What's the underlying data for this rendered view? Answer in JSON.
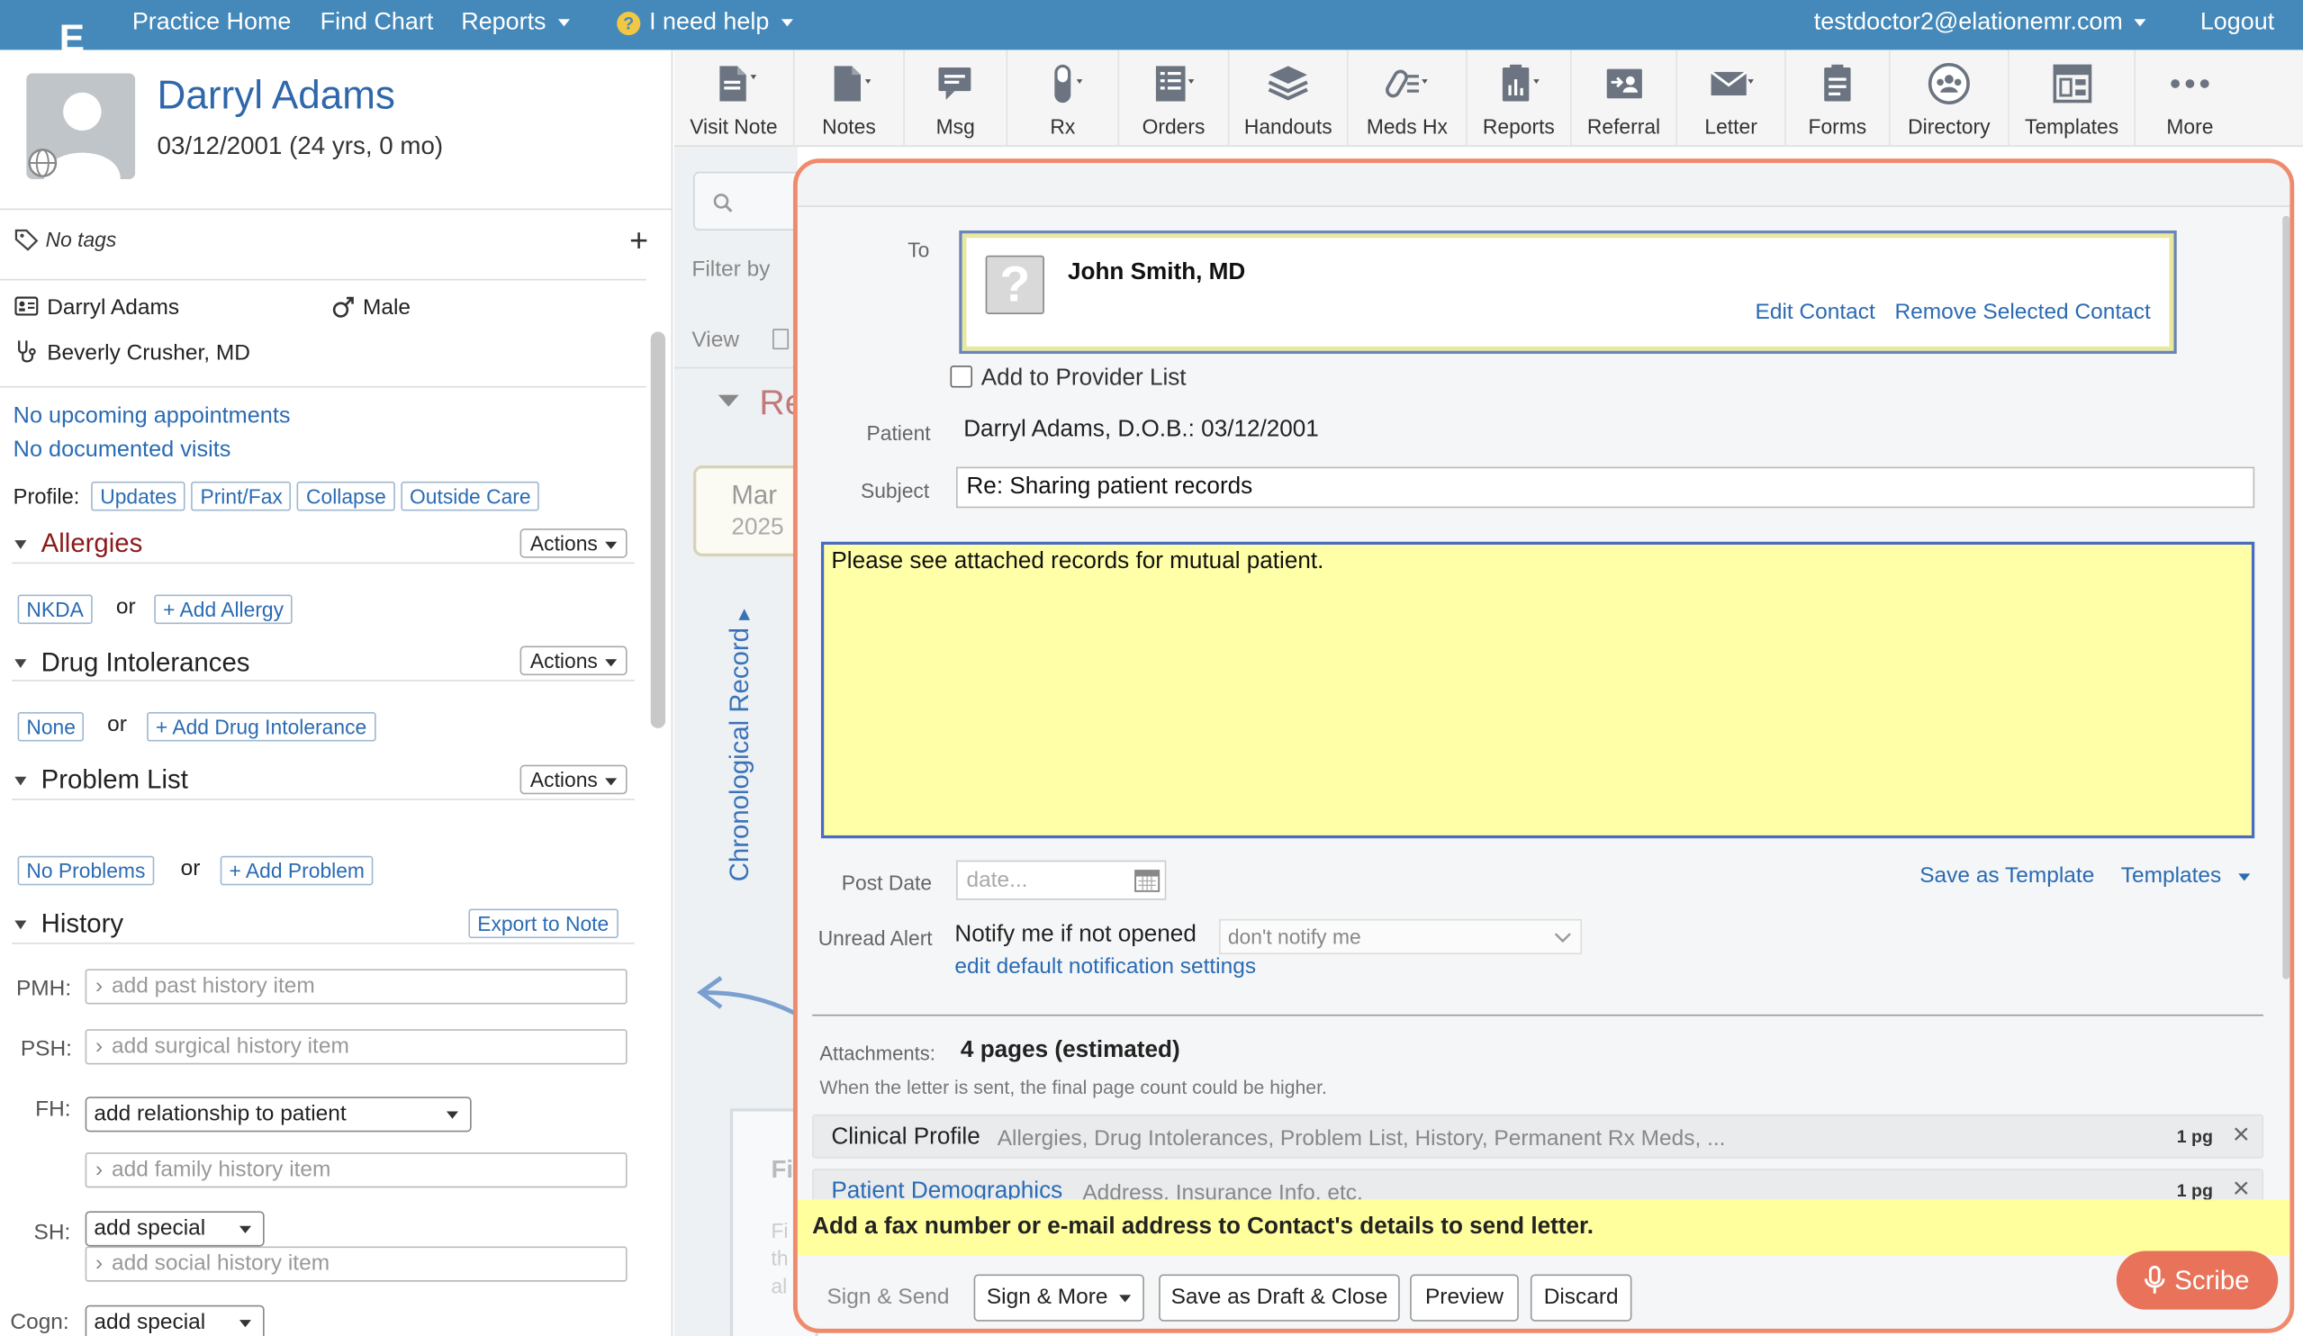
{
  "nav": {
    "logo_glyph": "E",
    "items": [
      "Practice Home",
      "Find Chart",
      "Reports"
    ],
    "help_badge": "?",
    "help": "I need help",
    "user": "testdoctor2@elationemr.com",
    "logout": "Logout"
  },
  "patient": {
    "name": "Darryl Adams",
    "dob": "03/12/2001 (24 yrs, 0 mo)",
    "tags": "No tags",
    "tag_add": "+",
    "display_name": "Darryl Adams",
    "sex": "Male",
    "provider": "Beverly Crusher, MD",
    "no_appointments": "No upcoming appointments",
    "no_visits": "No documented visits",
    "profile_label": "Profile:",
    "profile_buttons": [
      "Updates",
      "Print/Fax",
      "Collapse",
      "Outside Care"
    ]
  },
  "sections": {
    "allergies": {
      "title": "Allergies",
      "actions": "Actions",
      "none": "NKDA",
      "or": "or",
      "add": "+ Add Allergy"
    },
    "intolerances": {
      "title": "Drug Intolerances",
      "actions": "Actions",
      "none": "None",
      "or": "or",
      "add": "+ Add Drug Intolerance"
    },
    "problems": {
      "title": "Problem List",
      "actions": "Actions",
      "none": "No Problems",
      "or": "or",
      "add": "+ Add Problem"
    },
    "history": {
      "title": "History",
      "export": "Export to Note",
      "pmh_label": "PMH:",
      "pmh_ph": "add past history item",
      "psh_label": "PSH:",
      "psh_ph": "add surgical history item",
      "fh_label": "FH:",
      "fh_select": "add relationship to patient",
      "fh_ph": "add family history item",
      "sh_label": "SH:",
      "sh_select": "add special",
      "sh_ph": "add social history item",
      "cogn_label": "Cogn:",
      "cogn_select": "add special"
    }
  },
  "toolbar": [
    "Visit Note",
    "Notes",
    "Msg",
    "Rx",
    "Orders",
    "Handouts",
    "Meds Hx",
    "Reports",
    "Referral",
    "Letter",
    "Forms",
    "Directory",
    "Templates",
    "More"
  ],
  "middle": {
    "filter_by": "Filter by",
    "view": "View",
    "record_head": "Re",
    "date_month": "Mar",
    "date_year": "2025",
    "chron": "Chronological Record",
    "card_title": "Fi",
    "card_lines": [
      "Fi",
      "th",
      "al"
    ]
  },
  "letter": {
    "to_label": "To",
    "contact_name": "John Smith, MD",
    "contact_placeholder": "?",
    "edit_contact": "Edit Contact",
    "remove_contact": "Remove Selected Contact",
    "add_provider": "Add to Provider List",
    "patient_label": "Patient",
    "patient_value": "Darryl Adams, D.O.B.: 03/12/2001",
    "subject_label": "Subject",
    "subject_value": "Re: Sharing patient records",
    "body": "Please see attached records for mutual patient.",
    "post_date_label": "Post Date",
    "date_placeholder": "date...",
    "save_template": "Save as Template",
    "templates": "Templates",
    "unread_label": "Unread Alert",
    "notify_label": "Notify me if not opened",
    "notify_select": "don't notify me",
    "edit_notify": "edit default notification settings",
    "attachments_label": "Attachments:",
    "attachments_count": "4 pages (estimated)",
    "attachments_note": "When the letter is sent, the final page count could be higher.",
    "attachments": [
      {
        "title": "Clinical Profile",
        "desc": "Allergies, Drug Intolerances, Problem List, History, Permanent Rx Meds, ...",
        "pages": "1 pg",
        "remove": "×"
      },
      {
        "title": "Patient Demographics",
        "desc": "Address, Insurance Info, etc.",
        "pages": "1 pg",
        "remove": "×"
      }
    ],
    "warning": "Add a fax number or e-mail address to Contact's details to send letter.",
    "sign_send": "Sign & Send",
    "sign_more": "Sign & More",
    "save_draft": "Save as Draft & Close",
    "preview": "Preview",
    "discard": "Discard"
  },
  "scribe": "Scribe",
  "colors": {
    "nav": "#4589ba",
    "accent": "#f08a6c",
    "body_bg": "#ffffa8",
    "link": "#2a6bb3"
  }
}
